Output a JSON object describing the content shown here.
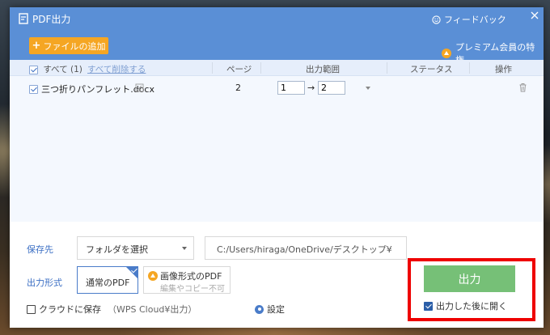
{
  "window": {
    "title": "PDF出力",
    "feedback": "フィードバック"
  },
  "toolbar": {
    "add_file": "ファイルの追加",
    "premium": "プレミアム会員の特権"
  },
  "list": {
    "header": {
      "select_all": "すべて (1)",
      "delete_all": "すべて削除する",
      "pages": "ページ",
      "range": "出力範囲",
      "status": "ステータス",
      "action": "操作"
    },
    "rows": [
      {
        "file_name": "三つ折りパンフレット.docx",
        "pages": "2",
        "range_from": "1",
        "range_to": "2",
        "range_arrow": "→",
        "status": ""
      }
    ]
  },
  "save": {
    "label": "保存先",
    "folder_select": "フォルダを選択",
    "path": "C:/Users/hiraga/OneDrive/デスクトップ¥"
  },
  "format": {
    "label": "出力形式",
    "normal": "通常のPDF",
    "image": "画像形式のPDF",
    "image_sub": "編集やコピー不可"
  },
  "cloud": {
    "label": "クラウドに保存",
    "note": "（WPS Cloud¥出力）"
  },
  "settings": {
    "label": "設定"
  },
  "export": {
    "button": "出力",
    "open_after": "出力した後に開く"
  },
  "colors": {
    "titlebar": "#5a8fd6",
    "accent": "#4a7cc9",
    "add_button": "#f5a623",
    "export_button": "#76c077",
    "highlight_frame": "#ee0000"
  }
}
